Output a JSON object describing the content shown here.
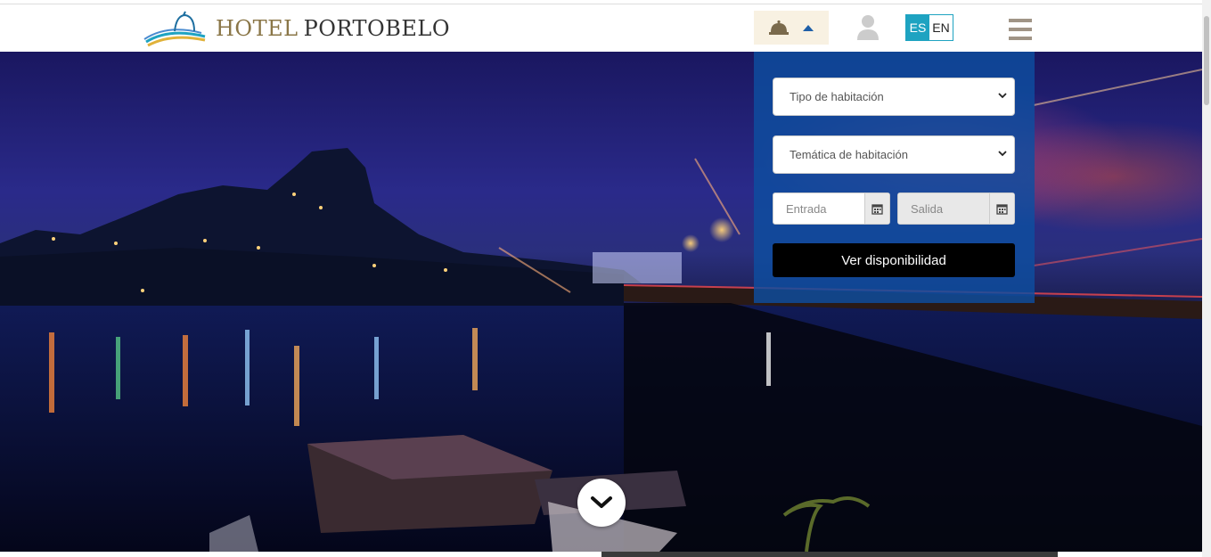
{
  "header": {
    "logo": {
      "word1": "HOTEL",
      "word2": "PORTOBELO"
    },
    "booking_toggle": {
      "icons": [
        "bell-icon",
        "caret-up-icon"
      ]
    },
    "user_icon": "user-icon",
    "languages": {
      "active": "ES",
      "inactive": "EN"
    },
    "menu_icon": "hamburger-icon"
  },
  "booking_form": {
    "room_type": {
      "placeholder": "Tipo de habitación"
    },
    "room_theme": {
      "placeholder": "Temática de habitación"
    },
    "check_in": {
      "placeholder": "Entrada"
    },
    "check_out": {
      "placeholder": "Salida"
    },
    "submit_label": "Ver disponibilidad"
  },
  "hero": {
    "scroll_icon": "chevron-down-icon"
  },
  "colors": {
    "accent": "#1ea3c1",
    "panel": "#0e4ea0",
    "logo_gold": "#8a7647",
    "menu_gray": "#a09486"
  }
}
